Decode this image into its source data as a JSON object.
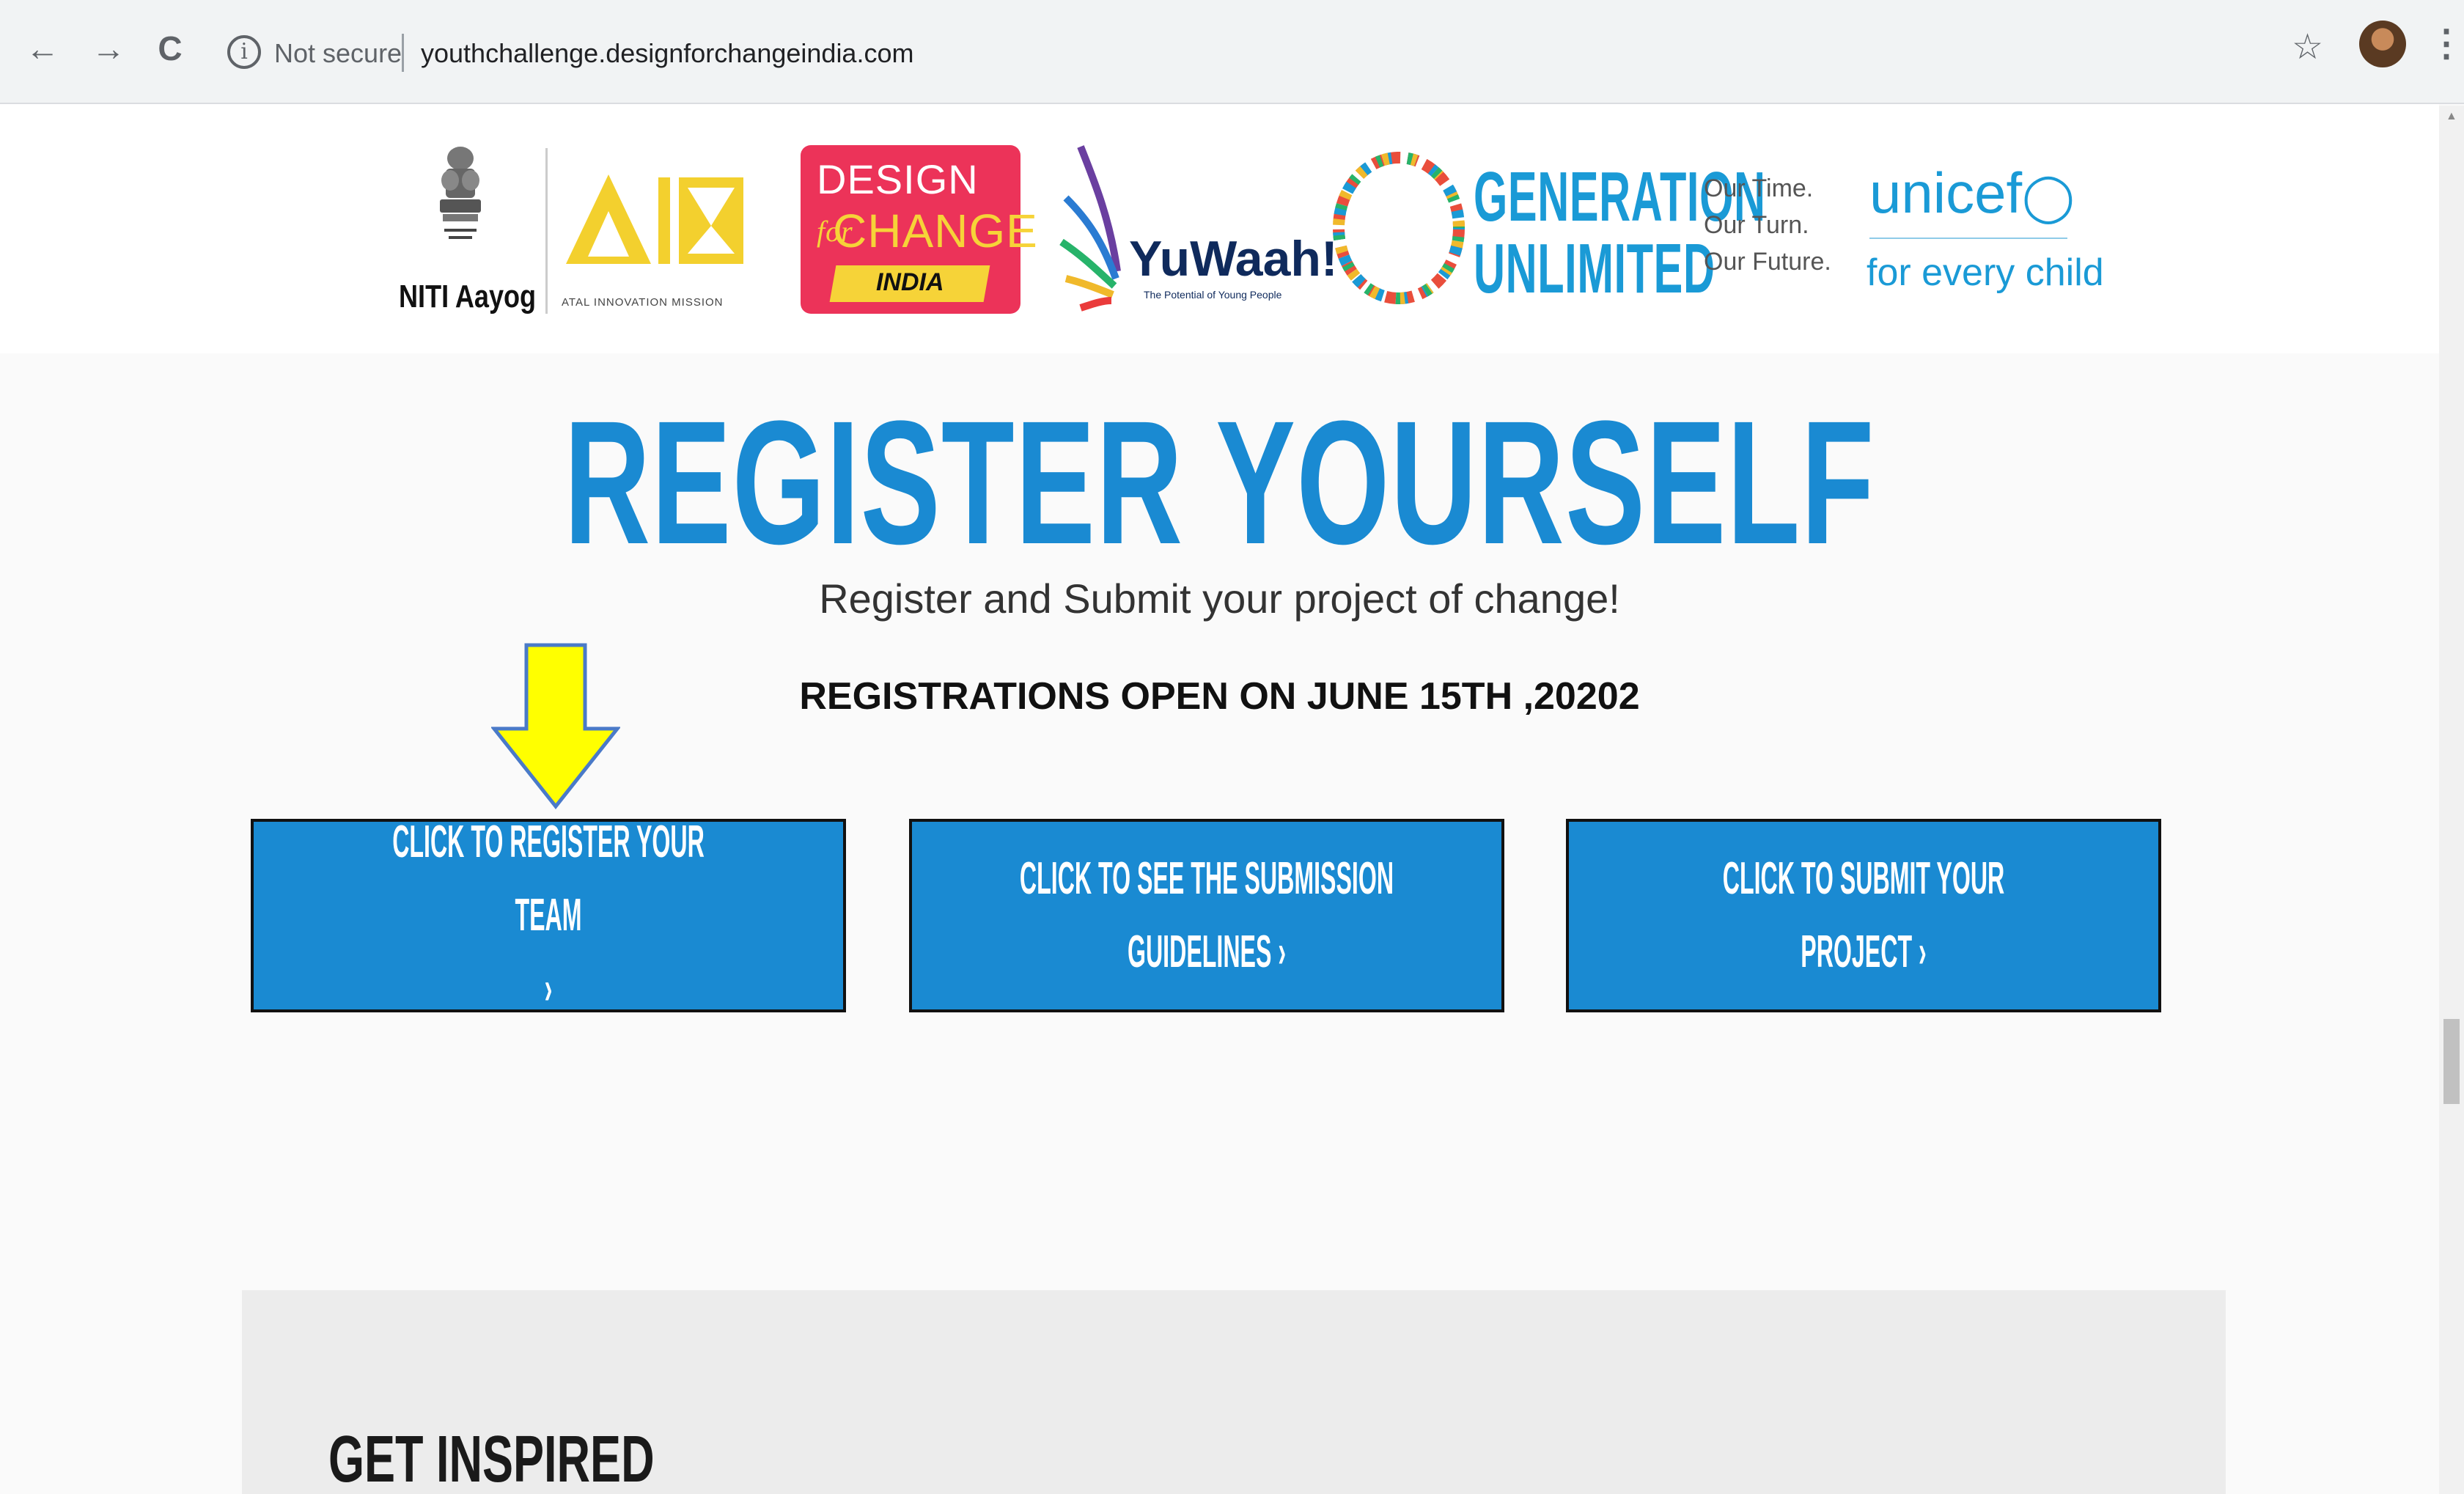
{
  "browser": {
    "nav": {
      "back": "←",
      "forward": "→",
      "reload": "C"
    },
    "omnibox": {
      "security_label": "Not secure",
      "url": "youthchallenge.designforchangeindia.com"
    },
    "icons": {
      "info": "info-icon",
      "star": "star-icon",
      "menu": "kebab-menu-icon"
    }
  },
  "logos": {
    "niti": "NITI Aayog",
    "aim_caption": "ATAL INNOVATION MISSION",
    "dfc": {
      "line1": "DESIGN",
      "for": "for",
      "line2": "CHANGE",
      "india": "INDIA"
    },
    "yuwaah": {
      "name": "YuWaah!",
      "tagline": "The Potential of Young People"
    },
    "generation": {
      "line1": "GENERATION",
      "line2": "UNLIMITED"
    },
    "generation_tag": [
      "Our Time.",
      "Our Turn.",
      "Our Future."
    ],
    "unicef": {
      "name": "unicef",
      "tagline": "for every child"
    }
  },
  "hero": {
    "title": "REGISTER YOURSELF",
    "subtitle": "Register and Submit your project of change!",
    "notice": "REGISTRATIONS OPEN ON JUNE 15TH ,20202"
  },
  "actions": [
    {
      "line1": "CLICK TO REGISTER YOUR TEAM",
      "line2": "›"
    },
    {
      "line1": "CLICK TO SEE THE SUBMISSION",
      "line2": "GUIDELINES  ›"
    },
    {
      "line1": "CLICK TO SUBMIT YOUR",
      "line2": "PROJECT  ›"
    }
  ],
  "section": {
    "title": "GET INSPIRED"
  },
  "colors": {
    "accent_blue": "#1a8ad2",
    "dfc_pink": "#ec3359",
    "dfc_yellow": "#f6d338",
    "annotation_arrow": "#ffff00"
  }
}
